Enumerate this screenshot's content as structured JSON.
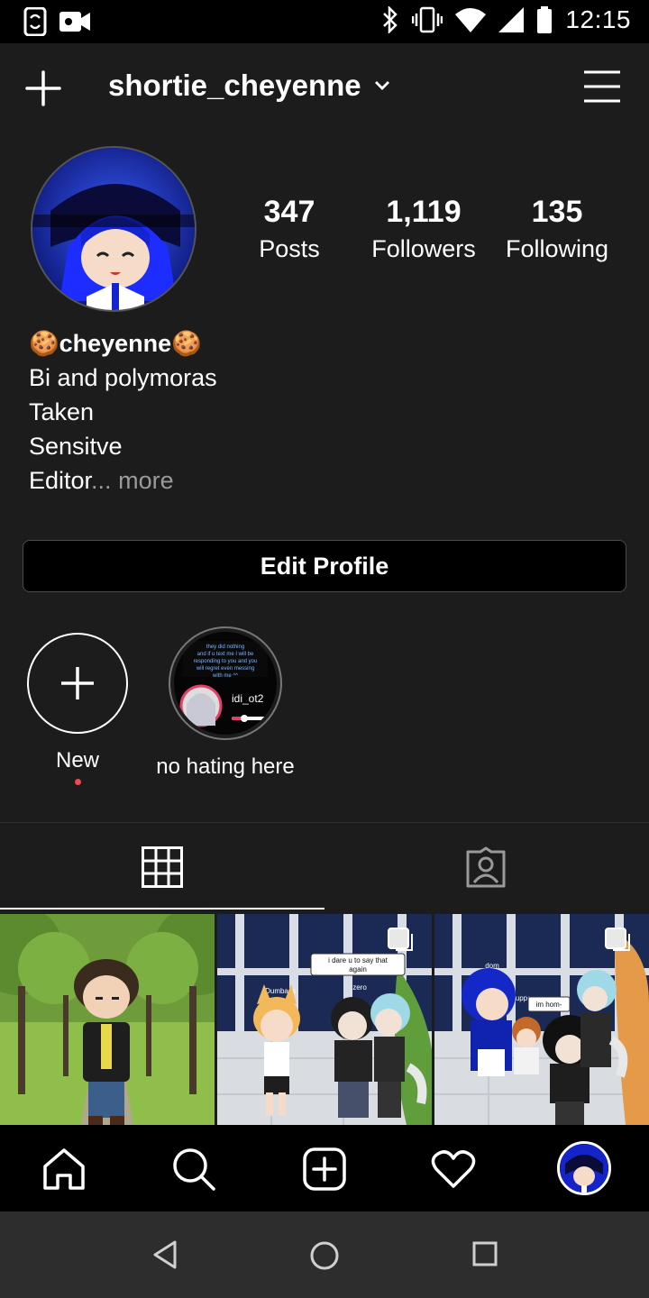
{
  "status_bar": {
    "time": "12:15",
    "icons": [
      "phone-sync-icon",
      "video-record-icon",
      "bluetooth-icon",
      "vibrate-icon",
      "wifi-icon",
      "cell-signal-icon",
      "battery-icon"
    ]
  },
  "header": {
    "username": "shortie_cheyenne",
    "icons": [
      "plus-icon",
      "chevron-down-icon",
      "hamburger-menu-icon"
    ]
  },
  "profile": {
    "stats": [
      {
        "value": "347",
        "label": "Posts"
      },
      {
        "value": "1,119",
        "label": "Followers"
      },
      {
        "value": "135",
        "label": "Following"
      }
    ],
    "bio": {
      "name": "🍪cheyenne🍪",
      "lines": [
        "Bi and polymoras",
        "Taken",
        "Sensitve"
      ],
      "last_line": "Editor",
      "ellipsis": "...",
      "more_label": "more"
    },
    "edit_profile_label": "Edit Profile"
  },
  "highlights": [
    {
      "label": "New",
      "icon": "plus-icon",
      "has_dot": true
    },
    {
      "label": "no hating here",
      "thumb_text": "they did nothing and if u text me I will be responding to you and you will regret even messing with me ^^",
      "thumb_user": "idi_ot2"
    }
  ],
  "tabs": [
    {
      "name": "grid",
      "icon": "grid-icon",
      "active": true
    },
    {
      "name": "tagged",
      "icon": "tagged-person-icon",
      "active": false
    }
  ],
  "posts": [
    {
      "caption": ""
    },
    {
      "caption": "i dare u to say that again",
      "names": [
        "Dumbass",
        "zero"
      ],
      "multi": true
    },
    {
      "caption": "im hom-",
      "names": [
        "dom",
        "upper",
        "zero"
      ],
      "multi": true
    }
  ],
  "bottom_nav": [
    "home-icon",
    "search-icon",
    "new-post-icon",
    "heart-icon",
    "profile-avatar-icon"
  ],
  "system_nav": [
    "back-icon",
    "home-circle-icon",
    "recents-icon"
  ],
  "colors": {
    "background": "#1c1c1c",
    "accent_red": "#ed4956",
    "muted": "#9a9a9a"
  }
}
